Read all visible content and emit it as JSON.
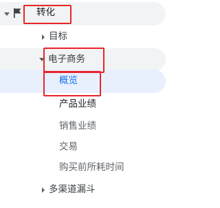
{
  "nav": {
    "conversions": {
      "label": "转化"
    },
    "goals": {
      "label": "目标"
    },
    "ecommerce": {
      "label": "电子商务"
    },
    "overview": {
      "label": "概览"
    },
    "product_performance": {
      "label": "产品业绩"
    },
    "sales_performance": {
      "label": "销售业绩"
    },
    "transactions": {
      "label": "交易"
    },
    "time_to_purchase": {
      "label": "购买前所耗时间"
    },
    "multi_channel_funnels": {
      "label": "多渠道漏斗"
    }
  },
  "colors": {
    "section_bg": "#f1f3f4",
    "selected_bg": "#e8f0fe",
    "selected_text": "#1a73e8",
    "highlight_border": "#e8242a",
    "text": "#3c4043",
    "muted_text": "#5f6368"
  }
}
